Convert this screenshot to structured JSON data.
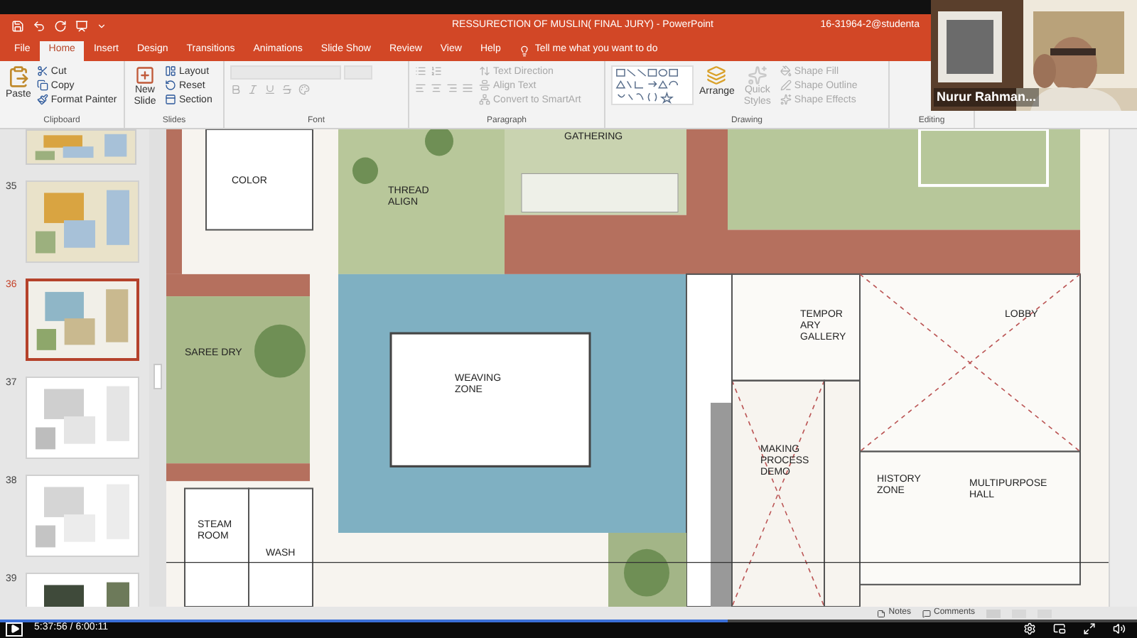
{
  "window": {
    "title": "RESSURECTION OF MUSLIN( FINAL JURY) - PowerPoint",
    "account": "16-31964-2@studenta"
  },
  "tabs": [
    {
      "label": "File",
      "selected": false
    },
    {
      "label": "Home",
      "selected": true
    },
    {
      "label": "Insert",
      "selected": false
    },
    {
      "label": "Design",
      "selected": false
    },
    {
      "label": "Transitions",
      "selected": false
    },
    {
      "label": "Animations",
      "selected": false
    },
    {
      "label": "Slide Show",
      "selected": false
    },
    {
      "label": "Review",
      "selected": false
    },
    {
      "label": "View",
      "selected": false
    },
    {
      "label": "Help",
      "selected": false
    }
  ],
  "tell_me": "Tell me what you want to do",
  "ribbon": {
    "clipboard": {
      "label": "Clipboard",
      "paste": "Paste",
      "items": [
        {
          "label": "Cut",
          "disabled": false
        },
        {
          "label": "Copy",
          "disabled": false
        },
        {
          "label": "Format Painter",
          "disabled": false
        }
      ]
    },
    "slides": {
      "label": "Slides",
      "new_slide": "New Slide",
      "items": [
        {
          "label": "Layout",
          "disabled": false
        },
        {
          "label": "Reset",
          "disabled": false
        },
        {
          "label": "Section",
          "disabled": false
        }
      ]
    },
    "font": {
      "label": "Font"
    },
    "paragraph": {
      "label": "Paragraph",
      "items": [
        {
          "label": "Text Direction",
          "disabled": true
        },
        {
          "label": "Align Text",
          "disabled": true
        },
        {
          "label": "Convert to SmartArt",
          "disabled": true
        }
      ]
    },
    "drawing": {
      "label": "Drawing",
      "arrange": "Arrange",
      "quick_styles": "Quick Styles",
      "items": [
        {
          "label": "Shape Fill",
          "disabled": true
        },
        {
          "label": "Shape Outline",
          "disabled": true
        },
        {
          "label": "Shape Effects",
          "disabled": true
        }
      ]
    },
    "editing": {
      "label": "Editing"
    }
  },
  "thumbnails": [
    {
      "number": "35",
      "selected": false
    },
    {
      "number": "36",
      "selected": true
    },
    {
      "number": "37",
      "selected": false
    },
    {
      "number": "38",
      "selected": false
    },
    {
      "number": "39",
      "selected": false
    }
  ],
  "slide": {
    "labels": [
      "COLOR",
      "THREAD ALIGN",
      "GATHERING",
      "SAREE DRY",
      "WEAVING ZONE",
      "STEAM ROOM",
      "WASH",
      "TEMPOR ARY GALLERY",
      "LOBBY",
      "MAKING PROCESS DEMO",
      "HISTORY ZONE",
      "MULTIPURPOSE HALL"
    ]
  },
  "status_bar": {
    "notes": "Notes",
    "comments": "Comments"
  },
  "video_tile": {
    "name": "Nurur Rahman..."
  },
  "player": {
    "time": "5:37:56 / 6:00:11",
    "level": 0.64
  }
}
